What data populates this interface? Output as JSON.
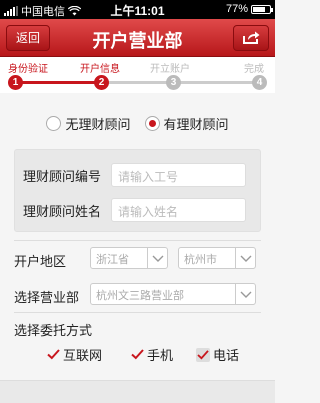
{
  "status_bar": {
    "carrier": "中国电信",
    "time": "上午11:01",
    "battery": "77%",
    "battery_level": 0.77
  },
  "header": {
    "back_label": "返回",
    "title": "开户营业部"
  },
  "steps": [
    {
      "label": "身份验证",
      "number": "1",
      "state": "done"
    },
    {
      "label": "开户信息",
      "number": "2",
      "state": "current"
    },
    {
      "label": "开立账户",
      "number": "3",
      "state": "pending"
    },
    {
      "label": "完成",
      "number": "4",
      "state": "pending"
    }
  ],
  "advisor_choice": {
    "options": [
      "无理财顾问",
      "有理财顾问"
    ],
    "selected": "有理财顾问"
  },
  "advisor": {
    "id_label": "理财顾问编号",
    "id_placeholder": "请输入工号",
    "name_label": "理财顾问姓名",
    "name_placeholder": "请输入姓名"
  },
  "region": {
    "label": "开户地区",
    "province": "浙江省",
    "city": "杭州市"
  },
  "branch": {
    "label": "选择营业部",
    "value": "杭州文三路营业部"
  },
  "entrust": {
    "label": "选择委托方式",
    "options": [
      {
        "label": "互联网",
        "checked": true
      },
      {
        "label": "手机",
        "checked": true
      },
      {
        "label": "电话",
        "checked": true
      }
    ]
  },
  "colors": {
    "brand": "#c8161d",
    "inactive": "#bbbbbb"
  }
}
